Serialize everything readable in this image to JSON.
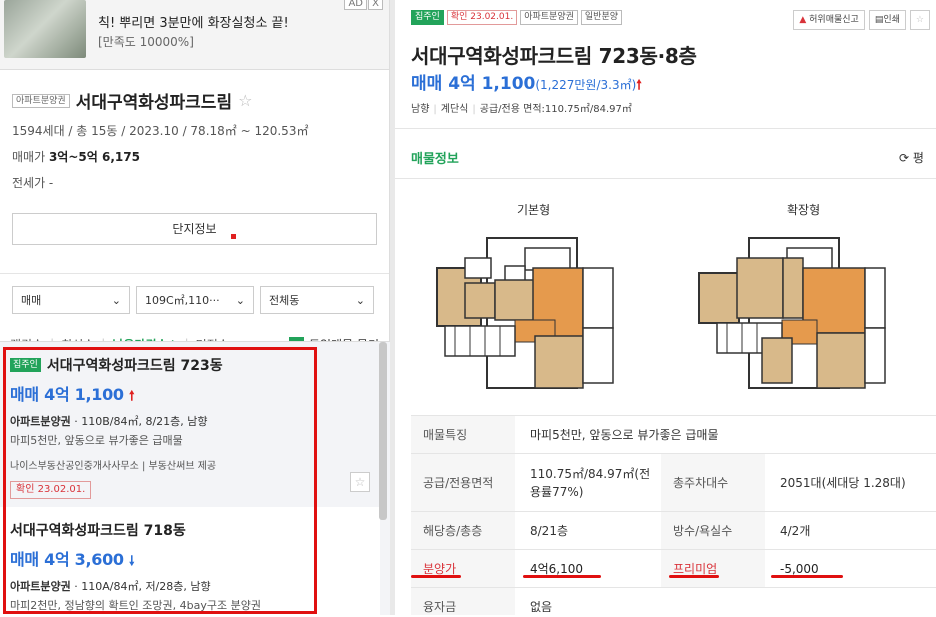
{
  "ad": {
    "title": "칙! 뿌리면 3분만에 화장실청소 끝!",
    "subtitle": "[만족도 10000%]",
    "tag": "AD",
    "close": "X"
  },
  "complex": {
    "badge": "아파트분양권",
    "name": "서대구역화성파크드림",
    "meta": "1594세대 / 총 15동 / 2023.10 / 78.18㎡ ~ 120.53㎡",
    "sale_label": "매매가",
    "sale_value": "3억~5억 6,175",
    "jeonse": "전세가 -",
    "info_button": "단지정보"
  },
  "filters": {
    "trade": "매매",
    "area": "109C㎡,110···",
    "dong": "전체동"
  },
  "sort": {
    "items": [
      "랭킹순",
      "최신순",
      "낮은가격순↓",
      "면적순"
    ],
    "group_label": "동일매물 묶기"
  },
  "listings": [
    {
      "badge": "집주인",
      "name": "서대구역화성파크드림 723동",
      "price": "매매 4억 1,100",
      "info_bold": "아파트분양권",
      "info": " · 110B/84㎡, 8/21층, 남향",
      "desc": "마피5천만, 앞동으로 뷰가좋은 급매물",
      "agent": "나이스부동산공인중개사사무소 | 부동산써브 제공",
      "confirm": "확인 23.02.01."
    },
    {
      "name": "서대구역화성파크드림 718동",
      "price": "매매 4억 3,600",
      "info_bold": "아파트분양권",
      "info": " · 110A/84㎡, 저/28층, 남향",
      "desc": "마피2천만, 정남향의 확트인 조망권, 4bay구조 분양권"
    }
  ],
  "detail": {
    "tags": [
      "집주인",
      "확인 23.02.01.",
      "아파트분양권",
      "일반분양"
    ],
    "report": "허위매물신고",
    "print": "인쇄",
    "title": "서대구역화성파크드림 723동·8층",
    "price": "매매 4억 1,100",
    "price_per": "(1,227만원/3.3㎡)",
    "sub": [
      "남향",
      "계단식",
      "공급/전용 면적:110.75㎡/84.97㎡"
    ],
    "tab": "매물정보",
    "refresh": "평",
    "plan_basic": "기본형",
    "plan_ext": "확장형",
    "rows": [
      {
        "h1": "매물특징",
        "v1": "마피5천만, 앞동으로 뷰가좋은 급매물"
      },
      {
        "h1": "공급/전용면적",
        "v1": "110.75㎡/84.97㎡(전용률77%)",
        "h2": "총주차대수",
        "v2": "2051대(세대당 1.28대)"
      },
      {
        "h1": "해당층/총층",
        "v1": "8/21층",
        "h2": "방수/욕실수",
        "v2": "4/2개"
      },
      {
        "h1": "분양가",
        "v1": "4억6,100",
        "h2": "프리미엄",
        "v2": "-5,000"
      },
      {
        "h1": "융자금",
        "v1": "없음"
      }
    ]
  }
}
